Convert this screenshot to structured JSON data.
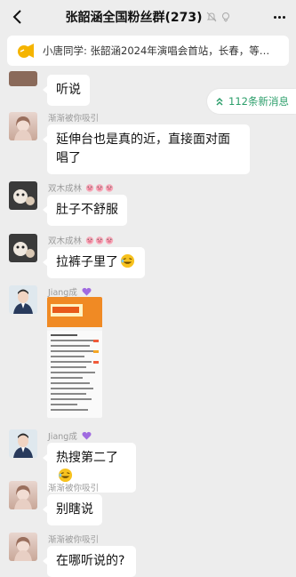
{
  "header": {
    "title": "张韶涵全国粉丝群(273)"
  },
  "notice": {
    "text": "小唐同学: 张韶涵2024年演唱会首站，长春，等…"
  },
  "new_messages": {
    "label": "112条新消息"
  },
  "messages": [
    {
      "sender": "",
      "text": "听说"
    },
    {
      "sender": "渐渐被你吸引",
      "text": "延伸台也是真的近，直接面对面唱了"
    },
    {
      "sender": "双木成林",
      "text": "肚子不舒服"
    },
    {
      "sender": "双木成林",
      "text": "拉裤子里了"
    },
    {
      "sender": "Jiang成",
      "text": ""
    },
    {
      "sender": "Jiang成",
      "text": "热搜第二了"
    },
    {
      "sender": "渐渐被你吸引",
      "text": "别瞎说"
    },
    {
      "sender": "渐渐被你吸引",
      "text": "在哪听说的?"
    }
  ],
  "colors": {
    "background": "#ededed",
    "bubble": "#ffffff",
    "accent_green": "#2b9e6a",
    "sender_gray": "#9a9a9a"
  },
  "icons": [
    "back-arrow-icon",
    "mute-icon",
    "ring-icon",
    "more-icon",
    "megaphone-icon",
    "double-chevron-up-icon",
    "pig-emoji",
    "purple-heart-emoji",
    "laughing-emoji"
  ]
}
